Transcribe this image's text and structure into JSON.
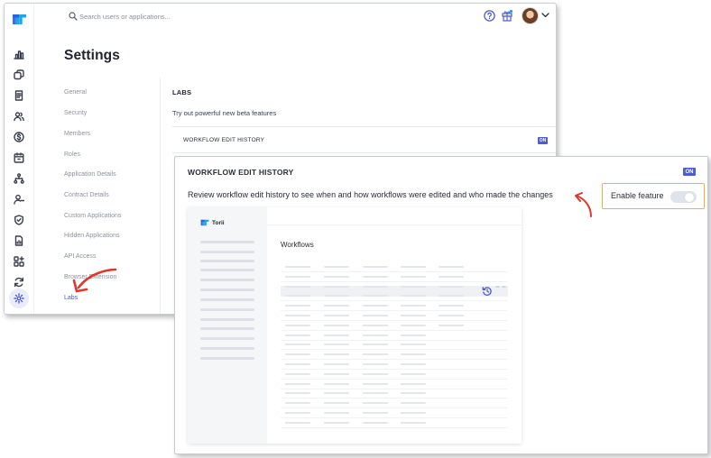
{
  "search": {
    "placeholder": "Search users or applications..."
  },
  "settings": {
    "title": "Settings",
    "nav": [
      {
        "label": "General"
      },
      {
        "label": "Security"
      },
      {
        "label": "Members"
      },
      {
        "label": "Roles"
      },
      {
        "label": "Application Details"
      },
      {
        "label": "Contract Details"
      },
      {
        "label": "Custom Applications"
      },
      {
        "label": "Hidden Applications"
      },
      {
        "label": "API Access"
      },
      {
        "label": "Browser Extension"
      },
      {
        "label": "Labs",
        "active": true
      }
    ]
  },
  "labs": {
    "heading": "LABS",
    "subtitle": "Try out powerful new beta features",
    "feature": {
      "name": "WORKFLOW EDIT HISTORY",
      "status": "ON"
    }
  },
  "panel": {
    "title": "WORKFLOW EDIT HISTORY",
    "status": "ON",
    "description": "Review workflow edit history to see when and how workflows were edited and who made the changes",
    "enable_label": "Enable feature",
    "enabled": false
  },
  "mock": {
    "brand": "Torii",
    "section_title": "Workflows"
  },
  "colors": {
    "accent": "#4a5cd6",
    "highlight_border": "#f2b233",
    "arrow": "#e0362c"
  },
  "icons": {
    "rail": [
      "dashboard-icon",
      "applications-icon",
      "contracts-icon",
      "users-icon",
      "expenses-icon",
      "renewals-icon",
      "workflows-icon",
      "offboarding-icon",
      "security-icon",
      "reports-icon",
      "integrations-icon",
      "sync-icon",
      "settings-icon"
    ]
  }
}
